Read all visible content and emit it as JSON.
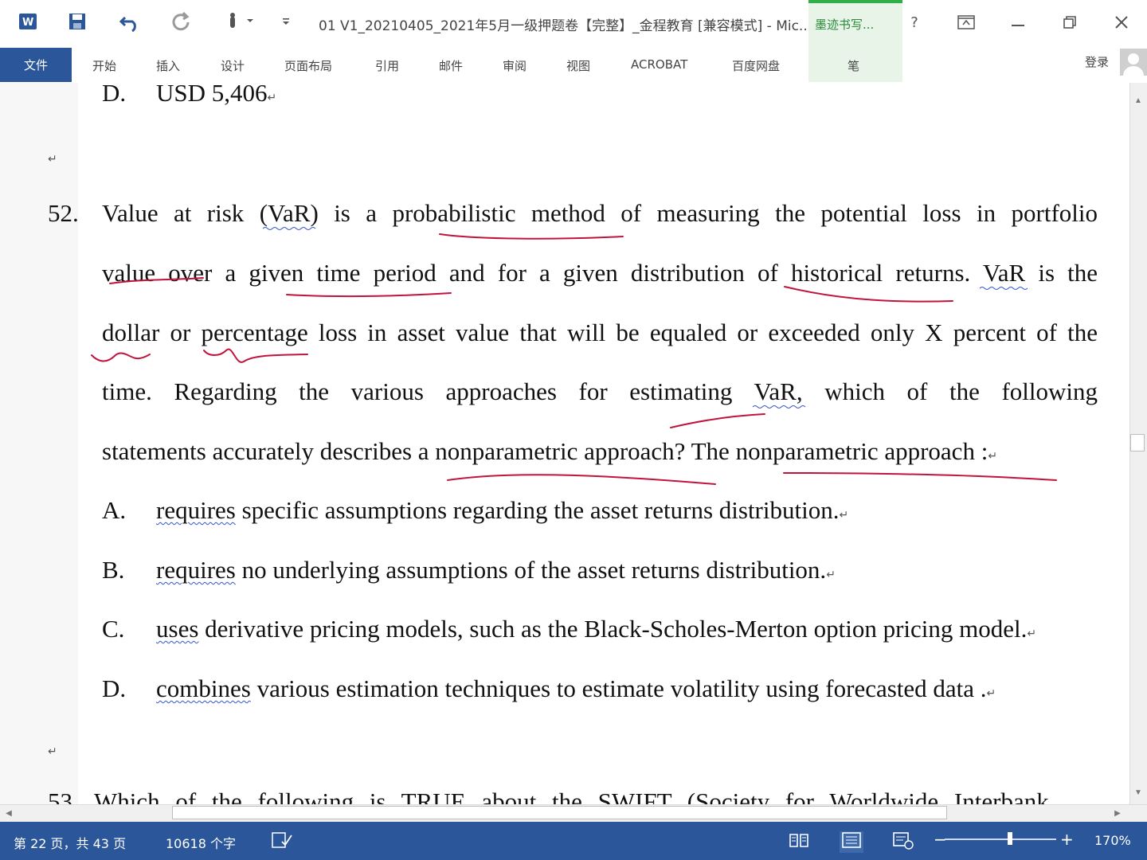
{
  "window": {
    "title": "01 V1_20210405_2021年5月一级押题卷【完整】_金程教育 [兼容模式] - Mic...",
    "ink_tab_top": "墨迹书写...",
    "help": "?"
  },
  "ribbon": {
    "tabs": [
      "文件",
      "开始",
      "插入",
      "设计",
      "页面布局",
      "引用",
      "邮件",
      "审阅",
      "视图",
      "ACROBAT",
      "百度网盘",
      "笔"
    ],
    "login": "登录"
  },
  "document": {
    "prev_option": {
      "label": "D.",
      "text": "USD 5,406"
    },
    "question": {
      "number": "52.",
      "lines": [
        "Value at risk (VaR) is a probabilistic method of measuring the potential loss in portfolio",
        "value over a given time period and for a given distribution of historical returns. VaR is the",
        "dollar or percentage loss in asset value that will be equaled or exceeded only X percent of the",
        "time. Regarding the various approaches for estimating VaR, which of the following",
        "statements accurately describes a nonparametric approach? The nonparametric approach :"
      ],
      "options": [
        {
          "label": "A.",
          "first": "requires",
          "rest": " specific assumptions regarding the asset returns distribution."
        },
        {
          "label": "B.",
          "first": "requires",
          "rest": " no underlying assumptions of the asset returns distribution."
        },
        {
          "label": "C.",
          "first": "uses",
          "rest": " derivative pricing models, such as the Black-Scholes-Merton option pricing model."
        },
        {
          "label": "D.",
          "first": "combines",
          "rest": " various estimation techniques to estimate volatility using forecasted data ."
        }
      ]
    },
    "next_question_partial": "53.   Which of the following is TRUE about the SWIFT (Society for Worldwide Interbank"
  },
  "statusbar": {
    "page": "第 22 页，共 43 页",
    "words": "10618 个字",
    "zoom": "170%"
  },
  "colors": {
    "accent": "#2b579a",
    "ink_pen": "#c0143c",
    "ink_tab": "#2fae4a"
  }
}
